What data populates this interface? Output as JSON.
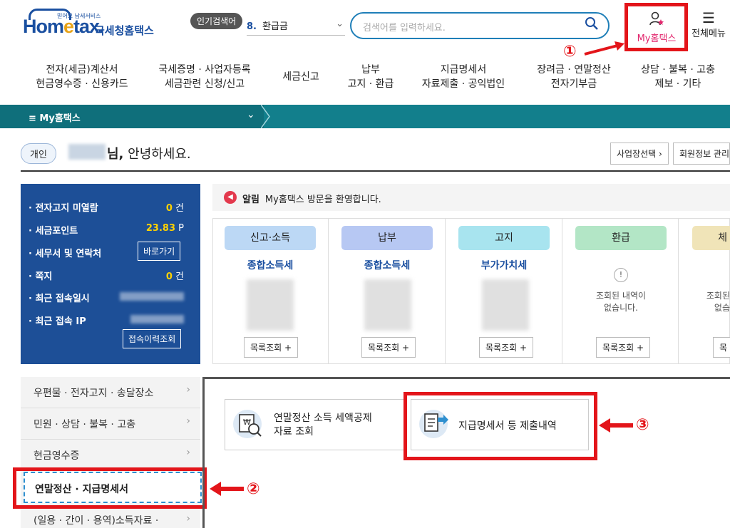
{
  "header": {
    "logo_main_a": "Hom",
    "logo_main_e": "e",
    "logo_main_b": "tax.",
    "logo_tagline": "믿어요 납세서비스",
    "logo_sub": "국세청홈택스",
    "popular_label": "인기검색어",
    "popular_num": "8.",
    "popular_term": "환급금",
    "search_placeholder": "검색어를 입력하세요.",
    "mytax_label": "My홈택스",
    "allmenu_label": "전체메뉴"
  },
  "annotations": {
    "a1": "①",
    "a2": "②",
    "a3": "③"
  },
  "nav": [
    {
      "line1": "전자(세금)계산서",
      "line2": "현금영수증 · 신용카드"
    },
    {
      "line1": "국세증명 · 사업자등록",
      "line2": "세금관련 신청/신고"
    },
    {
      "line1": "세금신고",
      "line2": ""
    },
    {
      "line1": "납부",
      "line2": "고지 · 환급"
    },
    {
      "line1": "지급명세서",
      "line2": "자료제출 · 공익법인"
    },
    {
      "line1": "장려금 · 연말정산",
      "line2": "전자기부금"
    },
    {
      "line1": "상담 · 불복 · 고충",
      "line2": "제보 · 기타"
    }
  ],
  "breadcrumb": {
    "label": "≡  My홈택스"
  },
  "greeting": {
    "badge": "개인",
    "suffix": "님,",
    "text": " 안녕하세요.",
    "btn_business": "사업장선택 ›",
    "btn_member": "회원정보 관리"
  },
  "summary": {
    "rows": [
      {
        "label": "· 전자고지 미열람",
        "value": "0",
        "unit": "건"
      },
      {
        "label": "· 세금포인트",
        "value": "23.83",
        "unit": "P"
      },
      {
        "label": "· 세무서 및 연락처",
        "button": "바로가기"
      },
      {
        "label": "· 쪽지",
        "value": "0",
        "unit": "건"
      },
      {
        "label": "· 최근 접속일시"
      },
      {
        "label": "· 최근 접속 IP"
      }
    ],
    "history_btn": "접속이력조회"
  },
  "notice": {
    "title": "알림",
    "text": "My홈택스 방문을 환영합니다."
  },
  "cards": [
    {
      "tab": "신고·소득",
      "title": "종합소득세",
      "btn": "목록조회 +",
      "color": "#bcd8f5"
    },
    {
      "tab": "납부",
      "title": "종합소득세",
      "btn": "목록조회 +",
      "color": "#b7c8f3"
    },
    {
      "tab": "고지",
      "title": "부가가치세",
      "btn": "목록조회 +",
      "color": "#a8e4ef"
    },
    {
      "tab": "환급",
      "empty1": "조회된 내역이",
      "empty2": "없습니다.",
      "btn": "목록조회 +",
      "color": "#b3e6c6"
    },
    {
      "tab": "체",
      "empty1": "조회된",
      "empty2": "없습",
      "btn": "목",
      "color": "#f0e4b8"
    }
  ],
  "leftmenu": [
    {
      "label": "우편물 · 전자고지 · 송달장소"
    },
    {
      "label": "민원 · 상담 · 불복 · 고충"
    },
    {
      "label": "현금영수증"
    },
    {
      "label": "연말정산 · 지급명세서"
    },
    {
      "label": "(일용 · 간이 · 용역)소득자료 ·"
    }
  ],
  "services": [
    {
      "line1": "연말정산 소득 세액공제",
      "line2": "자료 조회"
    },
    {
      "line1": "지급명세서 등 제출내역",
      "line2": ""
    }
  ],
  "colors": {
    "accent_red": "#e3151a",
    "brand_blue": "#1a4fa0",
    "teal_bar": "#127f8c",
    "panel_blue": "#1d4f97"
  }
}
